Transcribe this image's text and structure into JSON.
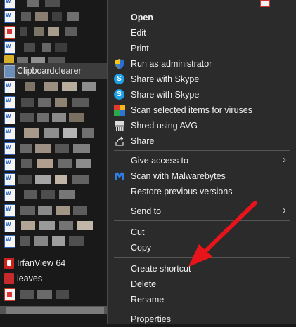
{
  "file_list": {
    "items": [
      {
        "icon": "word-doc-icon",
        "label": ""
      },
      {
        "icon": "pdf-icon",
        "label": ""
      },
      {
        "icon": "word-doc-icon",
        "label": ""
      },
      {
        "icon": "round-app-icon",
        "label": ""
      },
      {
        "icon": "clipboard-icon",
        "label": "Clipboardclearer"
      },
      {
        "icon": "word-doc-icon",
        "label": ""
      },
      {
        "icon": "word-doc-icon",
        "label": ""
      },
      {
        "icon": "word-doc-icon",
        "label": ""
      },
      {
        "icon": "word-doc-icon",
        "label": ""
      },
      {
        "icon": "word-doc-icon",
        "label": ""
      },
      {
        "icon": "word-doc-icon",
        "label": ""
      },
      {
        "icon": "word-doc-icon",
        "label": ""
      },
      {
        "icon": "word-doc-icon",
        "label": ""
      },
      {
        "icon": "word-doc-icon",
        "label": ""
      },
      {
        "icon": "word-doc-icon",
        "label": ""
      },
      {
        "icon": "word-doc-icon",
        "label": ""
      },
      {
        "icon": "irfanview-icon",
        "label": "IrfanView 64"
      },
      {
        "icon": "pdf-icon",
        "label": "leaves"
      }
    ]
  },
  "context_menu": {
    "items": {
      "open": "Open",
      "edit": "Edit",
      "print": "Print",
      "run_as_admin": "Run as administrator",
      "share_skype_1": "Share with Skype",
      "share_skype_2": "Share with Skype",
      "scan_viruses": "Scan selected items for viruses",
      "shred_avg": "Shred using AVG",
      "share": "Share",
      "give_access": "Give access to",
      "scan_malwarebytes": "Scan with Malwarebytes",
      "restore_versions": "Restore previous versions",
      "send_to": "Send to",
      "cut": "Cut",
      "copy": "Copy",
      "create_shortcut": "Create shortcut",
      "delete": "Delete",
      "rename": "Rename",
      "properties": "Properties"
    },
    "skype_glyph": "S",
    "submenu_arrow": "›"
  },
  "colors": {
    "menu_bg": "#2b2b2b",
    "list_bg": "#191919",
    "selected_row": "#3d3d3d",
    "annotation_arrow": "#e8141b"
  }
}
